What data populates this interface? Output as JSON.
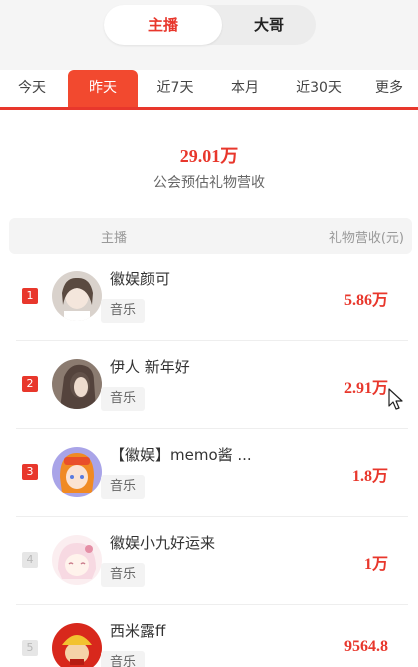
{
  "segment": {
    "anchor_label": "主播",
    "boss_label": "大哥"
  },
  "tabs": [
    "今天",
    "昨天",
    "近7天",
    "本月",
    "近30天",
    "更多"
  ],
  "active_tab": "昨天",
  "summary": {
    "value": "29.01万",
    "label": "公会预估礼物营收"
  },
  "table_header": {
    "anchor": "主播",
    "revenue": "礼物营收(元)"
  },
  "rows": [
    {
      "rank": "1",
      "name": "徽娱颜可",
      "tag": "音乐",
      "amount": "5.86万"
    },
    {
      "rank": "2",
      "name": "伊人 新年好",
      "tag": "音乐",
      "amount": "2.91万"
    },
    {
      "rank": "3",
      "name": "【徽娱】memo酱 ...",
      "tag": "音乐",
      "amount": "1.8万"
    },
    {
      "rank": "4",
      "name": "徽娱小九好运来",
      "tag": "音乐",
      "amount": "1万"
    },
    {
      "rank": "5",
      "name": "西米露ff",
      "tag": "音乐",
      "amount": "9564.8"
    }
  ],
  "colors": {
    "accent": "#e8372c",
    "tab_active": "#f2492f"
  }
}
